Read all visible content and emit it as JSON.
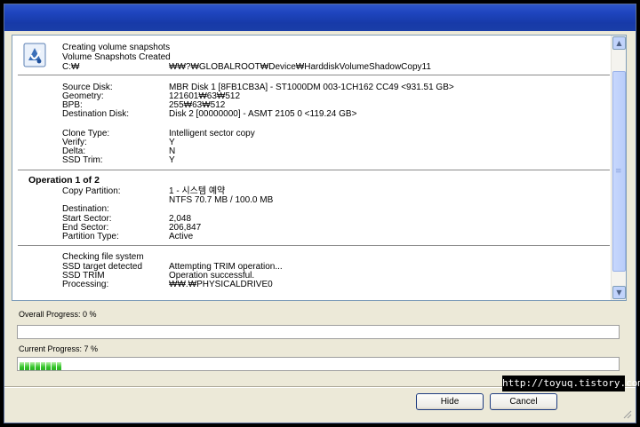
{
  "log": {
    "snapshot": {
      "line1": "Creating volume snapshots",
      "line2": "Volume Snapshots Created",
      "drive": "C:₩",
      "path": "₩₩?₩GLOBALROOT₩Device₩HarddiskVolumeShadowCopy11"
    },
    "disk_info": [
      {
        "label": "Source Disk:",
        "value": "MBR Disk 1 [8FB1CB3A] - ST1000DM 003-1CH162       CC49  <931.51 GB>"
      },
      {
        "label": "Geometry:",
        "value": "121601₩63₩512"
      },
      {
        "label": "BPB:",
        "value": "255₩63₩512"
      },
      {
        "label": "Destination Disk:",
        "value": " Disk 2 [00000000] - ASMT      2105                 0  <119.24 GB>"
      }
    ],
    "clone_info": [
      {
        "label": "Clone Type:",
        "value": "Intelligent sector copy"
      },
      {
        "label": "Verify:",
        "value": "Y"
      },
      {
        "label": "Delta:",
        "value": "N"
      },
      {
        "label": "SSD Trim:",
        "value": "Y"
      }
    ],
    "operation": {
      "heading": "Operation 1 of 2",
      "copy_label": "Copy Partition:",
      "copy_value_1": "1 - 시스템 예약",
      "copy_value_2": "NTFS 70.7 MB / 100.0 MB",
      "rows": [
        {
          "label": "Destination:",
          "value": ""
        },
        {
          "label": "Start Sector:",
          "value": "2,048"
        },
        {
          "label": "End Sector:",
          "value": "206,847"
        },
        {
          "label": "Partition Type:",
          "value": "Active"
        }
      ]
    },
    "status": [
      {
        "label": "Checking file system",
        "value": ""
      },
      {
        "label": "SSD target detected",
        "value": "Attempting TRIM operation..."
      },
      {
        "label": "SSD TRIM",
        "value": "Operation successful."
      },
      {
        "label": "Processing:",
        "value": "₩₩.₩PHYSICALDRIVE0"
      }
    ]
  },
  "overall": {
    "label": "Overall Progress:   0 %",
    "value": 0
  },
  "current": {
    "label": "Current Progress:   7 %",
    "value": 7
  },
  "buttons": {
    "hide": "Hide",
    "cancel": "Cancel"
  },
  "watermark": "http://toyuq.tistory.com"
}
